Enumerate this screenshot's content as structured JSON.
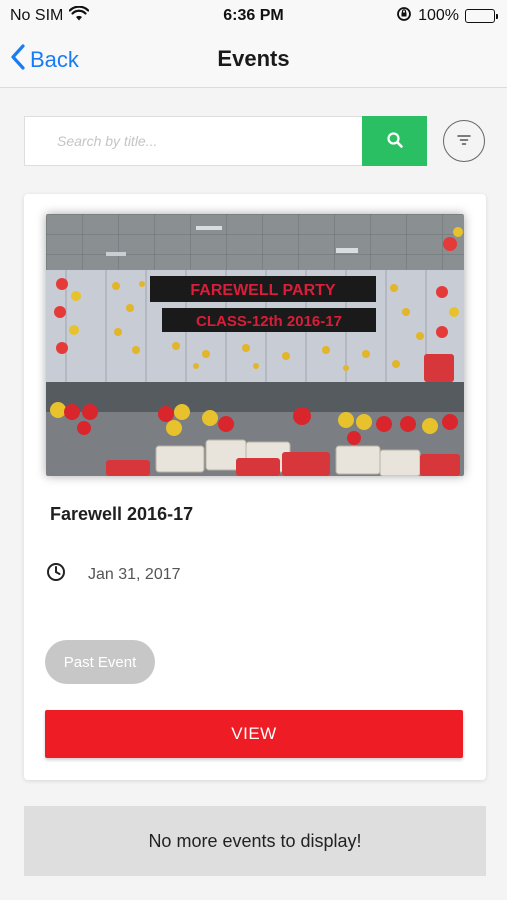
{
  "status_bar": {
    "carrier": "No SIM",
    "time": "6:36 PM",
    "battery": "100%"
  },
  "nav": {
    "back_label": "Back",
    "title": "Events"
  },
  "search": {
    "placeholder": "Search by title...",
    "value": ""
  },
  "events": [
    {
      "title": "Farewell 2016-17",
      "date": "Jan 31, 2017",
      "status": "Past Event",
      "action_label": "VIEW",
      "banner_line1": "FAREWELL PARTY",
      "banner_line2": "CLASS-12th 2016-17"
    }
  ],
  "footer": {
    "end_message": "No more events to display!"
  },
  "colors": {
    "accent_blue": "#1a7cf2",
    "search_green": "#2bbf63",
    "view_red": "#ee1c25",
    "pill_gray": "#c7c7c7"
  }
}
